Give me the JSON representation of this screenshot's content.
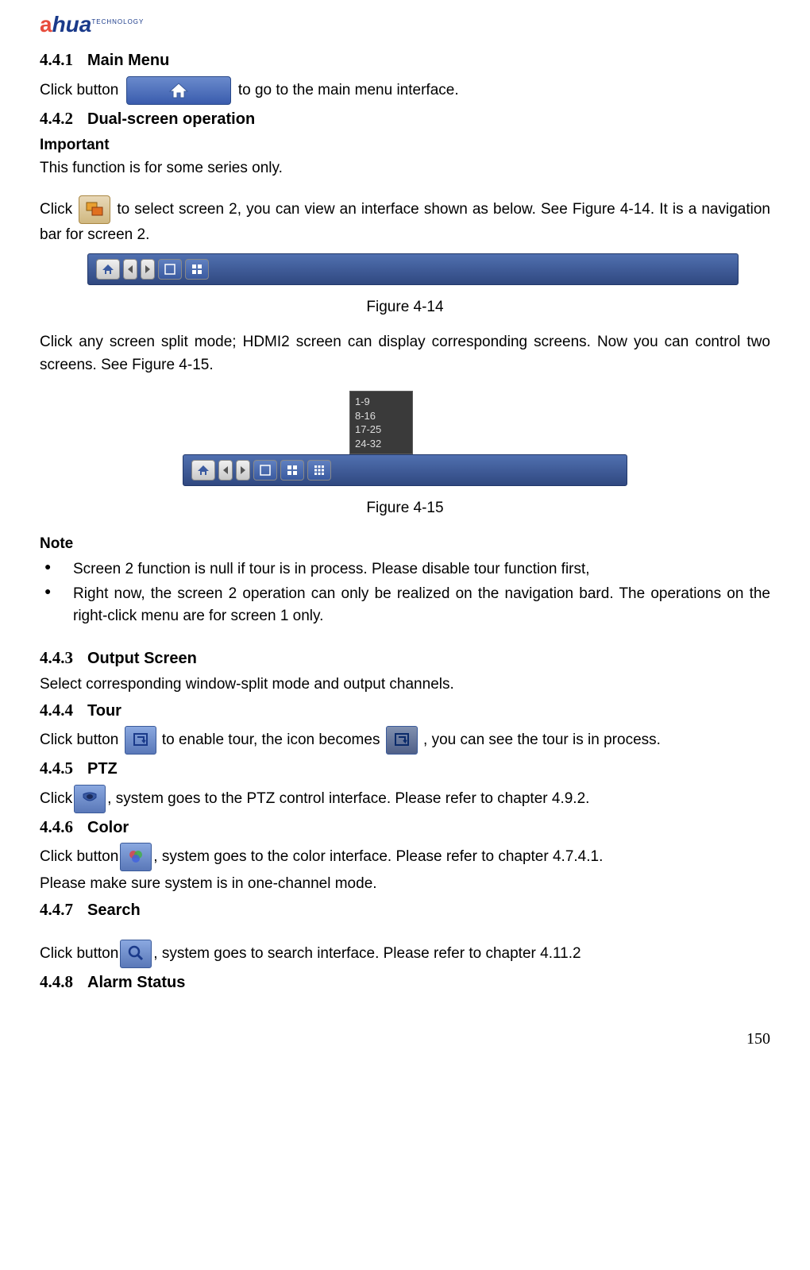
{
  "logo": {
    "brand_a": "a",
    "brand_hua": "hua",
    "tech": "TECHNOLOGY"
  },
  "s441": {
    "num": "4.4.1",
    "title": "Main Menu",
    "p1a": "Click button ",
    "p1b": " to go to the main menu interface."
  },
  "s442": {
    "num": "4.4.2",
    "title": "Dual-screen operation",
    "important": "Important",
    "p1": "This function is for some series only.",
    "p2a": "Click ",
    "p2b": " to select screen 2, you can view an interface shown as below. See Figure 4-14. It is a navigation bar for screen 2.",
    "fig14": "Figure 4-14",
    "p3": "Click any screen split mode; HDMI2 screen can display corresponding screens. Now you can control two screens. See Figure 4-15.",
    "popup": [
      "1-9",
      "8-16",
      "17-25",
      "24-32"
    ],
    "fig15": "Figure 4-15",
    "note": "Note",
    "b1": "Screen 2 function is null if tour is in process. Please disable tour function first,",
    "b2": "Right now, the screen 2 operation can only be realized on the navigation bard. The operations on the right-click menu are for screen 1 only."
  },
  "s443": {
    "num": "4.4.3",
    "title": "Output Screen",
    "p1": "Select corresponding window-split mode and output channels."
  },
  "s444": {
    "num": "4.4.4",
    "title": "Tour",
    "p1a": "Click button ",
    "p1b": " to enable tour, the icon becomes",
    "p1c": ", you can see the tour is in process."
  },
  "s445": {
    "num": "4.4.5",
    "title": "PTZ",
    "p1a": "Click",
    "p1b": ", system goes to the PTZ control interface. Please refer to chapter 4.9.2."
  },
  "s446": {
    "num": "4.4.6",
    "title": "Color",
    "p1a": "Click button",
    "p1b": ", system goes to the color interface. Please refer to chapter 4.7.4.1.",
    "p2": "Please make sure system is in one-channel mode."
  },
  "s447": {
    "num": "4.4.7",
    "title": "Search",
    "p1a": "Click button",
    "p1b": ", system goes to search interface. Please refer to chapter 4.11.2"
  },
  "s448": {
    "num": "4.4.8",
    "title": "Alarm Status"
  },
  "pagenum": "150"
}
